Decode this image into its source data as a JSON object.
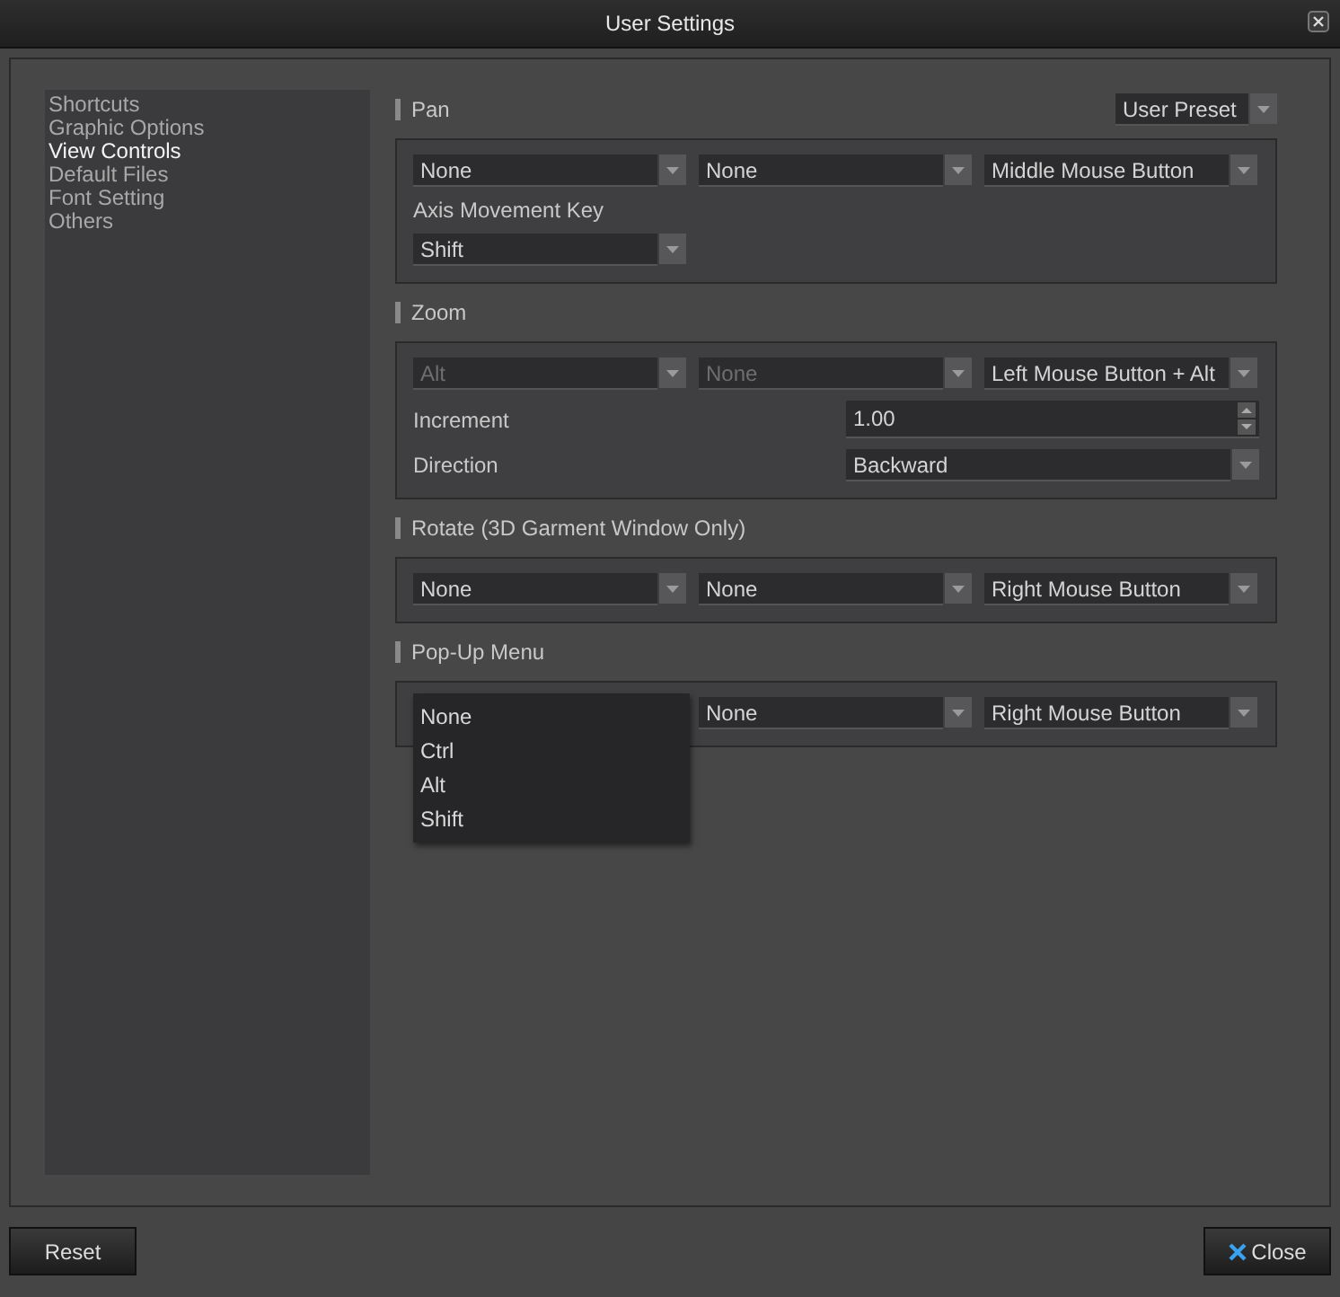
{
  "window": {
    "title": "User Settings"
  },
  "sidebar": {
    "items": [
      {
        "label": "Shortcuts",
        "selected": false
      },
      {
        "label": "Graphic Options",
        "selected": false
      },
      {
        "label": "View Controls",
        "selected": true
      },
      {
        "label": "Default Files",
        "selected": false
      },
      {
        "label": "Font Setting",
        "selected": false
      },
      {
        "label": "Others",
        "selected": false
      }
    ]
  },
  "preset": {
    "value": "User Preset"
  },
  "sections": [
    {
      "title": "Pan",
      "rows": [
        {
          "kind": "combos",
          "combos": [
            {
              "value": "None",
              "disabled": false
            },
            {
              "value": "None",
              "disabled": false
            },
            {
              "value": "Middle Mouse Button",
              "disabled": false
            }
          ]
        },
        {
          "kind": "label",
          "text": "Axis Movement Key"
        },
        {
          "kind": "single",
          "combo": {
            "value": "Shift",
            "disabled": false
          }
        }
      ]
    },
    {
      "title": "Zoom",
      "rows": [
        {
          "kind": "combos",
          "combos": [
            {
              "value": "Alt",
              "disabled": true
            },
            {
              "value": "None",
              "disabled": true
            },
            {
              "value": "Left Mouse Button + Alt",
              "disabled": false
            }
          ]
        },
        {
          "kind": "spin",
          "label": "Increment",
          "value": "1.00"
        },
        {
          "kind": "select",
          "label": "Direction",
          "value": "Backward"
        }
      ]
    },
    {
      "title": "Rotate (3D Garment Window Only)",
      "rows": [
        {
          "kind": "combos",
          "combos": [
            {
              "value": "None",
              "disabled": false
            },
            {
              "value": "None",
              "disabled": false
            },
            {
              "value": "Right Mouse Button",
              "disabled": false
            }
          ]
        }
      ]
    },
    {
      "title": "Pop-Up Menu",
      "rows": [
        {
          "kind": "combos",
          "combos": [
            {
              "open": true,
              "options": [
                "None",
                "Ctrl",
                "Alt",
                "Shift"
              ]
            },
            {
              "value": "None",
              "disabled": false
            },
            {
              "value": "Right Mouse Button",
              "disabled": false
            }
          ]
        }
      ]
    }
  ],
  "buttons": {
    "reset": "Reset",
    "close": "Close"
  }
}
